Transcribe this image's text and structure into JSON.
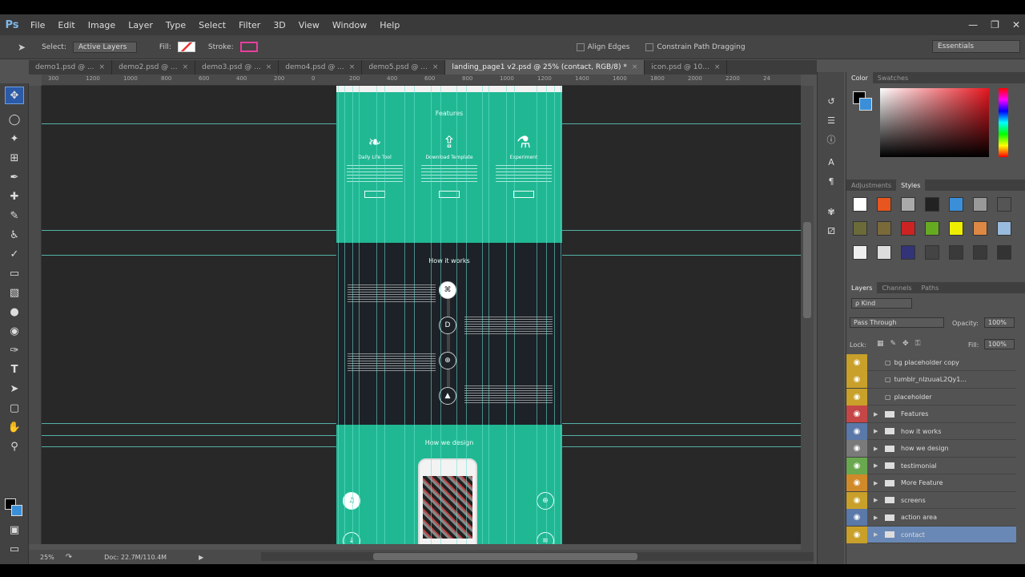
{
  "menubar": {
    "logo": "Ps",
    "items": [
      "File",
      "Edit",
      "Image",
      "Layer",
      "Type",
      "Select",
      "Filter",
      "3D",
      "View",
      "Window",
      "Help"
    ],
    "controls": [
      "—",
      "❐",
      "✕"
    ]
  },
  "options": {
    "select_label": "Select:",
    "select_value": "Active Layers",
    "fill_label": "Fill:",
    "stroke_label": "Stroke:",
    "stroke_color": "#e83e9d",
    "align_edges": "Align Edges",
    "constrain": "Constrain Path Dragging",
    "workspace": "Essentials"
  },
  "tabs": [
    {
      "label": "demo1.psd @ ...",
      "active": false
    },
    {
      "label": "demo2.psd @ ...",
      "active": false
    },
    {
      "label": "demo3.psd @ ...",
      "active": false
    },
    {
      "label": "demo4.psd @ ...",
      "active": false
    },
    {
      "label": "demo5.psd @ ...",
      "active": false
    },
    {
      "label": "landing_page1 v2.psd @ 25% (contact, RGB/8) *",
      "active": true
    },
    {
      "label": "icon.psd @ 10...",
      "active": false
    }
  ],
  "ruler_ticks": [
    "300",
    "1200",
    "1000",
    "800",
    "600",
    "400",
    "200",
    "0",
    "200",
    "400",
    "600",
    "800",
    "1000",
    "1200",
    "1400",
    "1600",
    "1800",
    "2000",
    "2200",
    "24"
  ],
  "canvas": {
    "features_title": "Features",
    "features": [
      {
        "icon": "❧",
        "name": "Daily Life Tool"
      },
      {
        "icon": "⇪",
        "name": "Download Template"
      },
      {
        "icon": "⚗",
        "name": "Experiment"
      }
    ],
    "howitworks_title": "How it works",
    "steps": [
      "⌘",
      "D",
      "⊕",
      "▲"
    ],
    "howwedesign_title": "How we design",
    "design_icons": [
      "♫",
      "⊕",
      "↓",
      "≡"
    ]
  },
  "status": {
    "zoom": "25%",
    "doc": "Doc: 22.7M/110.4M"
  },
  "panels": {
    "color_tabs": [
      "Color",
      "Swatches"
    ],
    "styles_tabs": [
      "Adjustments",
      "Styles"
    ],
    "layer_tabs": [
      "Layers",
      "Channels",
      "Paths"
    ],
    "kind": "ρ Kind",
    "blend_mode": "Pass Through",
    "opacity_label": "Opacity:",
    "opacity": "100%",
    "lock_label": "Lock:",
    "fill_label": "Fill:",
    "fill": "100%",
    "layers": [
      {
        "name": "bg placeholder copy",
        "color": "#c8a02a",
        "type": "layer",
        "selected": false
      },
      {
        "name": "tumblr_nlzuuaL2Qy1...",
        "color": "#c8a02a",
        "type": "smart",
        "selected": false
      },
      {
        "name": "placeholder",
        "color": "#c8a02a",
        "type": "layer",
        "selected": false
      },
      {
        "name": "Features",
        "color": "#c54646",
        "type": "group",
        "selected": false
      },
      {
        "name": "how it works",
        "color": "#5a78a8",
        "type": "group",
        "selected": false
      },
      {
        "name": "how we design",
        "color": "#7a7a7a",
        "type": "group",
        "selected": false
      },
      {
        "name": "testimonial",
        "color": "#6aa84f",
        "type": "group",
        "selected": false
      },
      {
        "name": "More Feature",
        "color": "#d18a2a",
        "type": "group",
        "selected": false
      },
      {
        "name": "screens",
        "color": "#c8a02a",
        "type": "group",
        "selected": false
      },
      {
        "name": "action area",
        "color": "#5a78a8",
        "type": "group",
        "selected": false
      },
      {
        "name": "contact",
        "color": "#c8a02a",
        "type": "group",
        "selected": true
      }
    ]
  }
}
